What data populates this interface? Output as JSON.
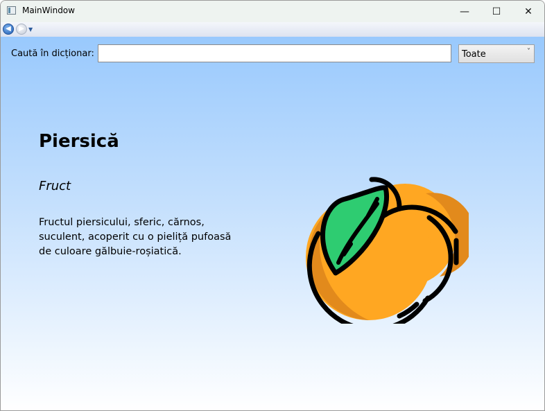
{
  "window": {
    "title": "MainWindow"
  },
  "title_controls": {
    "minimize": "—",
    "maximize": "☐",
    "close": "✕"
  },
  "navigation": {
    "back_glyph": "◀",
    "forward_glyph": "▶",
    "dropdown_glyph": "▼"
  },
  "search": {
    "label": "Caută în dicționar:",
    "value": "",
    "placeholder": ""
  },
  "filter": {
    "selected": "Toate",
    "chevron": "˅"
  },
  "entry": {
    "word": "Piersică",
    "category": "Fruct",
    "definition": "Fructul piersicului, sferic, cărnos, suculent, acoperit cu o pieliță pufoasă de culoare gălbuie-roșiatică.",
    "image_icon": "peach-icon"
  },
  "colors": {
    "peach_light": "#FFA722",
    "peach_dark": "#E28A1C",
    "leaf": "#2ECC71",
    "outline": "#000000",
    "background_top": "#99C9FD",
    "background_bottom": "#FFFFFF"
  }
}
